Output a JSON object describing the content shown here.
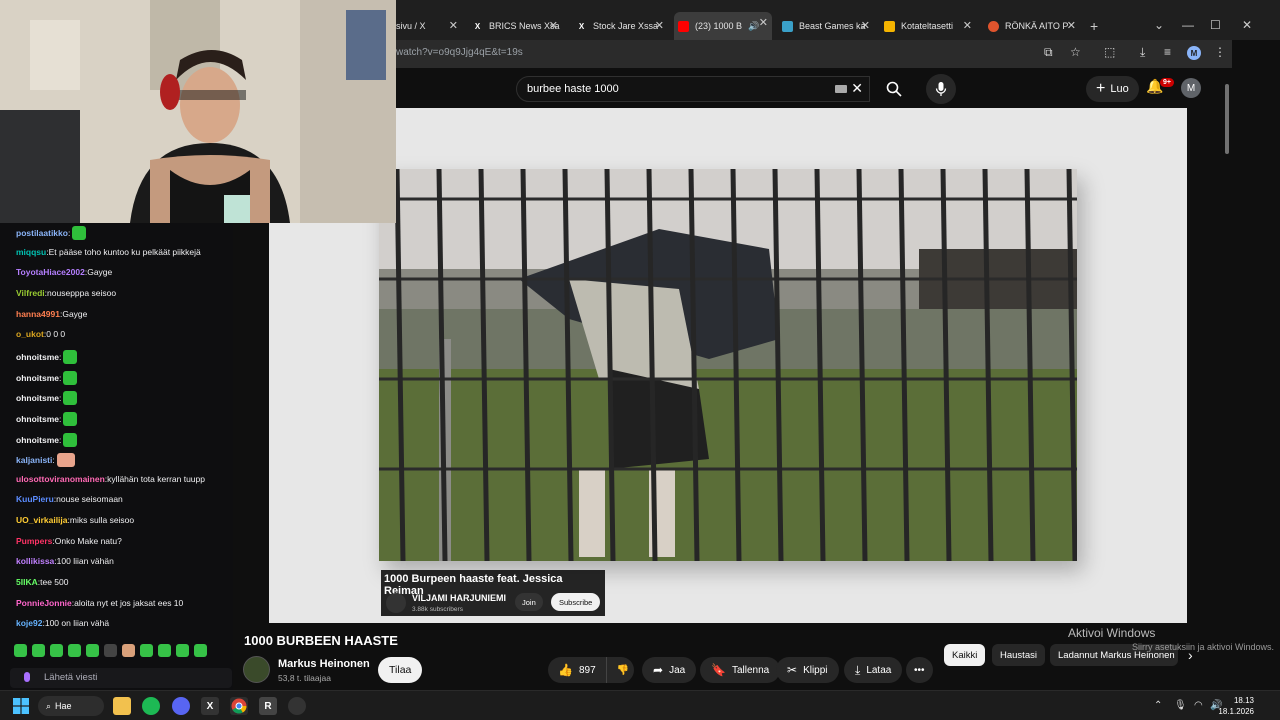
{
  "browser": {
    "tabs": [
      {
        "label": "sivu / X",
        "favicon": "x-logo"
      },
      {
        "label": "BRICS News Xsa",
        "favicon": "x-logo"
      },
      {
        "label": "Stock Jare Xssa",
        "favicon": "x-logo"
      },
      {
        "label": "(23) 1000 B",
        "favicon": "youtube-logo",
        "active": true
      },
      {
        "label": "Beast Games ka",
        "favicon": "tab-icon"
      },
      {
        "label": "Kotateltasetti",
        "favicon": "folder-icon"
      },
      {
        "label": "RÖNKÄ AITO P",
        "favicon": "tab-icon"
      }
    ],
    "url": "watch?v=o9q9Jjg4qE&t=19s"
  },
  "youtube": {
    "search_query": "burbee haste 1000",
    "create_label": "Luo",
    "notifications_badge": "9+",
    "user_initial": "M"
  },
  "embed": {
    "title": "1000 Burpeen haaste feat. Jessica Reiman",
    "channel": "VILJAMI HARJUNIEMI",
    "subscribers": "3.88k subscribers",
    "join_label": "Join",
    "subscribe_label": "Subscribe"
  },
  "video": {
    "title": "1000 BURBEEN HAASTE",
    "channel_name": "Markus Heinonen",
    "channel_subs": "53,8 t. tilaajaa",
    "subscribe_label": "Tilaa",
    "likes": "897",
    "share_label": "Jaa",
    "save_label": "Tallenna",
    "clip_label": "Klippi",
    "download_label": "Lataa",
    "more_label": "•••"
  },
  "chips": [
    "Kaikki",
    "Haustasi",
    "Ladannut Markus Heinonen"
  ],
  "watermark": {
    "line1": "Aktivoi Windows",
    "line2": "Siirry asetuksiin ja aktivoi Windows."
  },
  "chat": {
    "messages": [
      {
        "user": "postilaatikko",
        "color": "#8ab4f8",
        "text": ""
      },
      {
        "user": "miqqsu",
        "color": "#00c2b2",
        "text": "Et pääse toho kuntoo ku pelkäät piikkejä"
      },
      {
        "user": "ToyotaHiace2002",
        "color": "#b57fff",
        "text": "Gayge"
      },
      {
        "user": "Vilfredi",
        "color": "#9acd32",
        "text": "nousepppa seisoo"
      },
      {
        "user": "hanna4991",
        "color": "#ff7f50",
        "text": "Gayge"
      },
      {
        "user": "o_ukot",
        "color": "#daa520",
        "text": "0 0 0"
      },
      {
        "user": "ohnoitsme",
        "color": "#efeff1",
        "text": ""
      },
      {
        "user": "ohnoitsme",
        "color": "#efeff1",
        "text": ""
      },
      {
        "user": "ohnoitsme",
        "color": "#efeff1",
        "text": ""
      },
      {
        "user": "ohnoitsme",
        "color": "#efeff1",
        "text": ""
      },
      {
        "user": "ohnoitsme",
        "color": "#efeff1",
        "text": ""
      },
      {
        "user": "kaljanisti",
        "color": "#8ab4f8",
        "text": ""
      },
      {
        "user": "ulosottoviranomainen",
        "color": "#ff69b4",
        "text": "kyllähän tota kerran tuupp"
      },
      {
        "user": "KuuPieru",
        "color": "#5b8cff",
        "text": "nouse seisomaan"
      },
      {
        "user": "UO_virkailija",
        "color": "#ffcc33",
        "text": "miks sulla seisoo"
      },
      {
        "user": "Pumpers",
        "color": "#ff3366",
        "text": "Onko Make natu?"
      },
      {
        "user": "kollikissa",
        "color": "#c080ff",
        "text": "100 liian vähän"
      },
      {
        "user": "5IIKA",
        "color": "#66ff66",
        "text": "tee 500"
      },
      {
        "user": "PonnieJonnie",
        "color": "#ff66cc",
        "text": "aloita nyt et jos jaksat ees 10"
      },
      {
        "user": "koje92",
        "color": "#66b3ff",
        "text": "100 on liian vähä"
      }
    ],
    "input_placeholder": "Lähetä viesti"
  },
  "taskbar": {
    "search_label": "Hae",
    "time": "18.13",
    "date": "18.1.2026"
  }
}
